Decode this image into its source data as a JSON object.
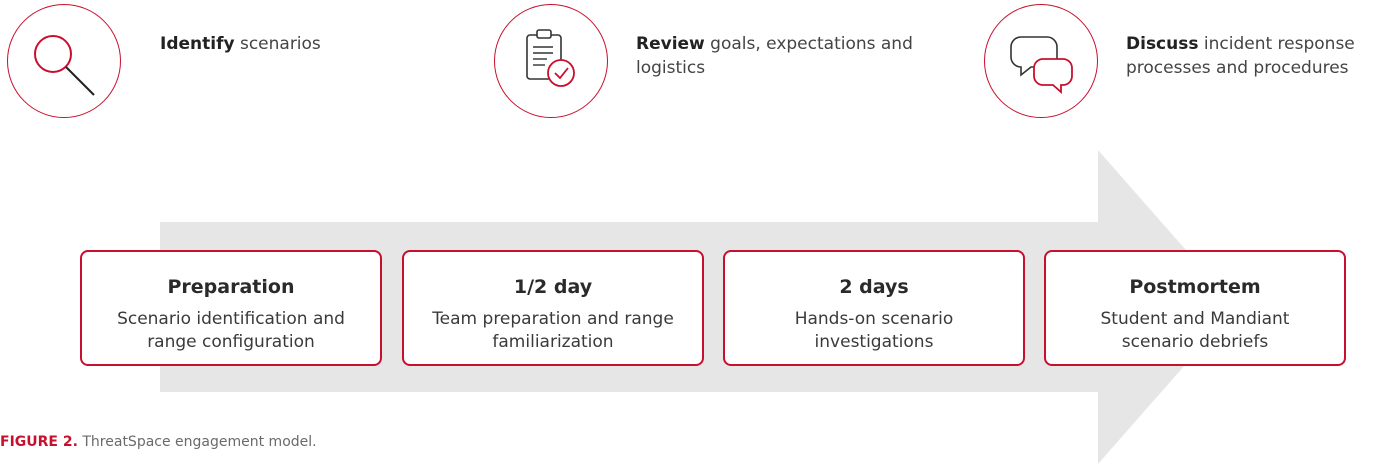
{
  "steps": [
    {
      "bold": "Identify",
      "rest": " scenarios",
      "icon": "magnifier-icon"
    },
    {
      "bold": "Review",
      "rest": " goals, expectations and logistics",
      "icon": "clipboard-check-icon"
    },
    {
      "bold": "Discuss",
      "rest": " incident response processes and procedures",
      "icon": "chat-bubbles-icon"
    }
  ],
  "phases": [
    {
      "title": "Preparation",
      "desc": "Scenario identification and range configuration"
    },
    {
      "title": "1/2 day",
      "desc": "Team preparation and range familiarization"
    },
    {
      "title": "2 days",
      "desc": "Hands-on scenario investigations"
    },
    {
      "title": "Postmortem",
      "desc": "Student and Mandiant scenario debriefs"
    }
  ],
  "caption": {
    "label": "FIGURE 2.",
    "text": " ThreatSpace engagement model."
  },
  "colors": {
    "accent": "#c8102e",
    "arrow": "#e6e6e6"
  }
}
